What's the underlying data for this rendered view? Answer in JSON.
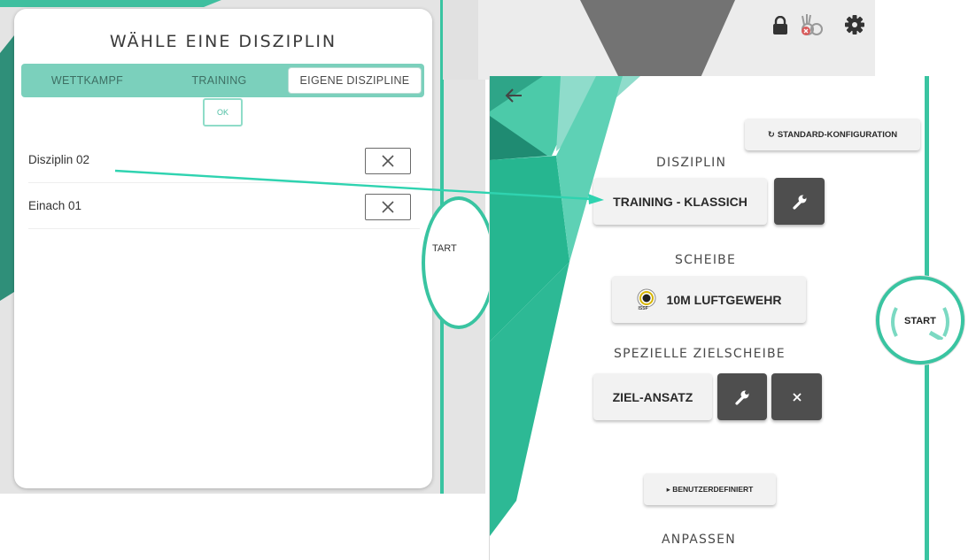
{
  "dialog": {
    "title": "WÄHLE EINE DISZIPLIN",
    "tabs": [
      {
        "label": "WETTKAMPF",
        "active": false
      },
      {
        "label": "TRAINING",
        "active": false
      },
      {
        "label": "EIGENE DISZIPLINE",
        "active": true
      }
    ],
    "ok_label": "OK",
    "disciplines": [
      {
        "name": "Disziplin 02",
        "delete_icon": "close-icon"
      },
      {
        "name": "Einach 01",
        "delete_icon": "close-icon"
      }
    ]
  },
  "left_start": {
    "label": "TART"
  },
  "top_bar": {
    "icons": [
      "lock-icon",
      "muted-shot-icon",
      "gear-icon"
    ]
  },
  "config": {
    "back_icon": "arrow-left-icon",
    "standard_button": "STANDARD-KONFIGURATION",
    "disziplin_label": "DISZIPLIN",
    "disziplin_value": "TRAINING - KLASSICH",
    "scheibe_label": "SCHEIBE",
    "scheibe_value": "10M LUFTGEWEHR",
    "scheibe_badge": "ISSF",
    "ziel_label": "SPEZIELLE ZIELSCHEIBE",
    "ziel_value": "ZIEL-ANSATZ",
    "benutzer_button": "▸ BENUTZERDEFINIERT",
    "anpassen_label": "ANPASSEN"
  },
  "right_start": {
    "label": "START"
  },
  "colors": {
    "accent": "#39c4a1",
    "accent_light": "#7bd0bc",
    "arrow": "#2fd3b0",
    "dark_button": "#4e4e4e"
  }
}
